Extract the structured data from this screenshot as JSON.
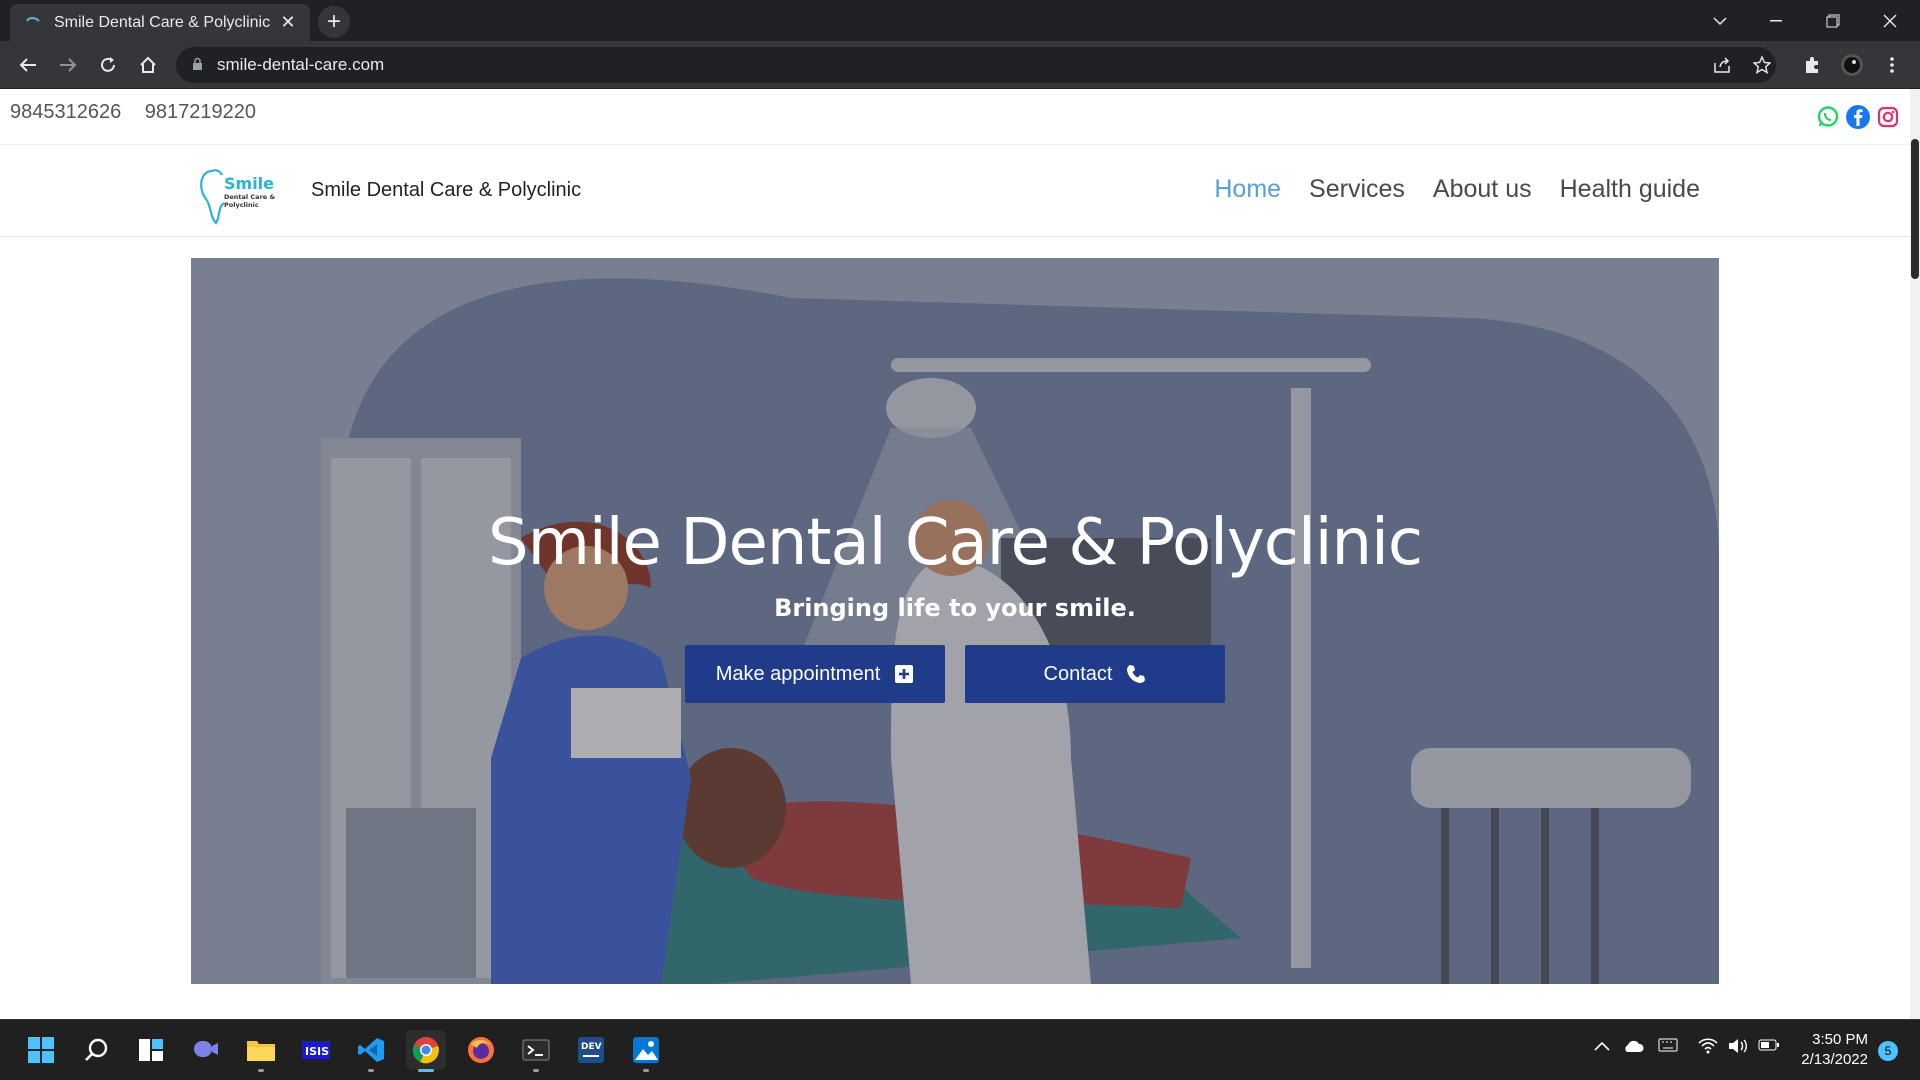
{
  "browser": {
    "tab_title": "Smile Dental Care & Polyclinic",
    "tab_close": "✕",
    "new_tab": "+",
    "url": "smile-dental-care.com"
  },
  "site": {
    "phones": [
      "9845312626",
      "9817219220"
    ],
    "social": [
      "whatsapp-icon",
      "facebook-icon",
      "instagram-icon"
    ],
    "logo": {
      "word": "Smile",
      "line1": "Dental Care &",
      "line2": "Polyclinic"
    },
    "brand": "Smile Dental Care & Polyclinic",
    "nav": [
      {
        "label": "Home",
        "active": true
      },
      {
        "label": "Services",
        "active": false
      },
      {
        "label": "About us",
        "active": false
      },
      {
        "label": "Health guide",
        "active": false
      }
    ],
    "hero": {
      "title": "Smile Dental Care & Polyclinic",
      "subtitle": "Bringing life to your smile.",
      "btn_appointment": "Make appointment",
      "btn_contact": "Contact"
    },
    "colors": {
      "accent": "#5aa0d8",
      "button": "#1f3b8a"
    }
  },
  "taskbar": {
    "time": "3:50 PM",
    "date": "2/13/2022",
    "notifications": "5"
  }
}
